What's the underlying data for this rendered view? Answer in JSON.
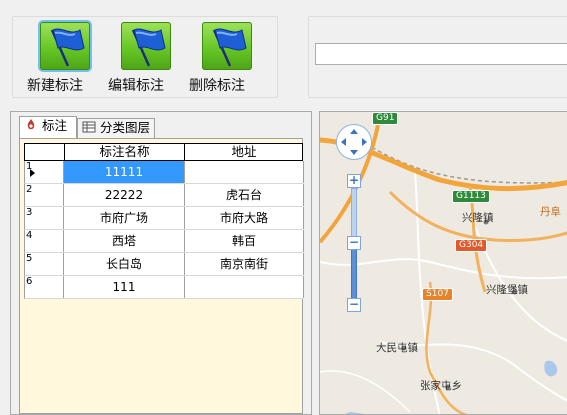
{
  "toolbar": {
    "buttons": [
      {
        "label": "新建标注",
        "icon": "blue-flag-icon",
        "selected": true
      },
      {
        "label": "编辑标注",
        "icon": "blue-flag-icon",
        "selected": false
      },
      {
        "label": "删除标注",
        "icon": "blue-flag-icon",
        "selected": false
      }
    ]
  },
  "search": {
    "value": "",
    "placeholder": ""
  },
  "tabs": [
    {
      "label": "标注",
      "icon": "marker-icon",
      "active": true
    },
    {
      "label": "分类图层",
      "icon": "layers-icon",
      "active": false
    }
  ],
  "grid": {
    "columns": [
      "标注名称",
      "地址"
    ],
    "rows": [
      {
        "num": "1",
        "name": "11111",
        "address": "",
        "selected": true
      },
      {
        "num": "2",
        "name": "22222",
        "address": "虎石台",
        "selected": false
      },
      {
        "num": "3",
        "name": "市府广场",
        "address": "市府大路",
        "selected": false
      },
      {
        "num": "4",
        "name": "西塔",
        "address": "韩百",
        "selected": false
      },
      {
        "num": "5",
        "name": "长白岛",
        "address": "南京南街",
        "selected": false
      },
      {
        "num": "6",
        "name": "111",
        "address": "",
        "selected": false
      }
    ]
  },
  "map": {
    "places": [
      "兴隆镇",
      "兴隆堡镇",
      "大民屯镇",
      "张家屯乡",
      "丹阜"
    ],
    "road_shields": [
      "G91",
      "G1113",
      "G304",
      "S107"
    ],
    "zoom_in": "+",
    "zoom_out": "−",
    "zoom_minus_small": "−",
    "colors": {
      "highway": "#f2a53b",
      "road": "#ffffff",
      "water": "#a9c8ec",
      "land": "#eeeae1"
    }
  }
}
